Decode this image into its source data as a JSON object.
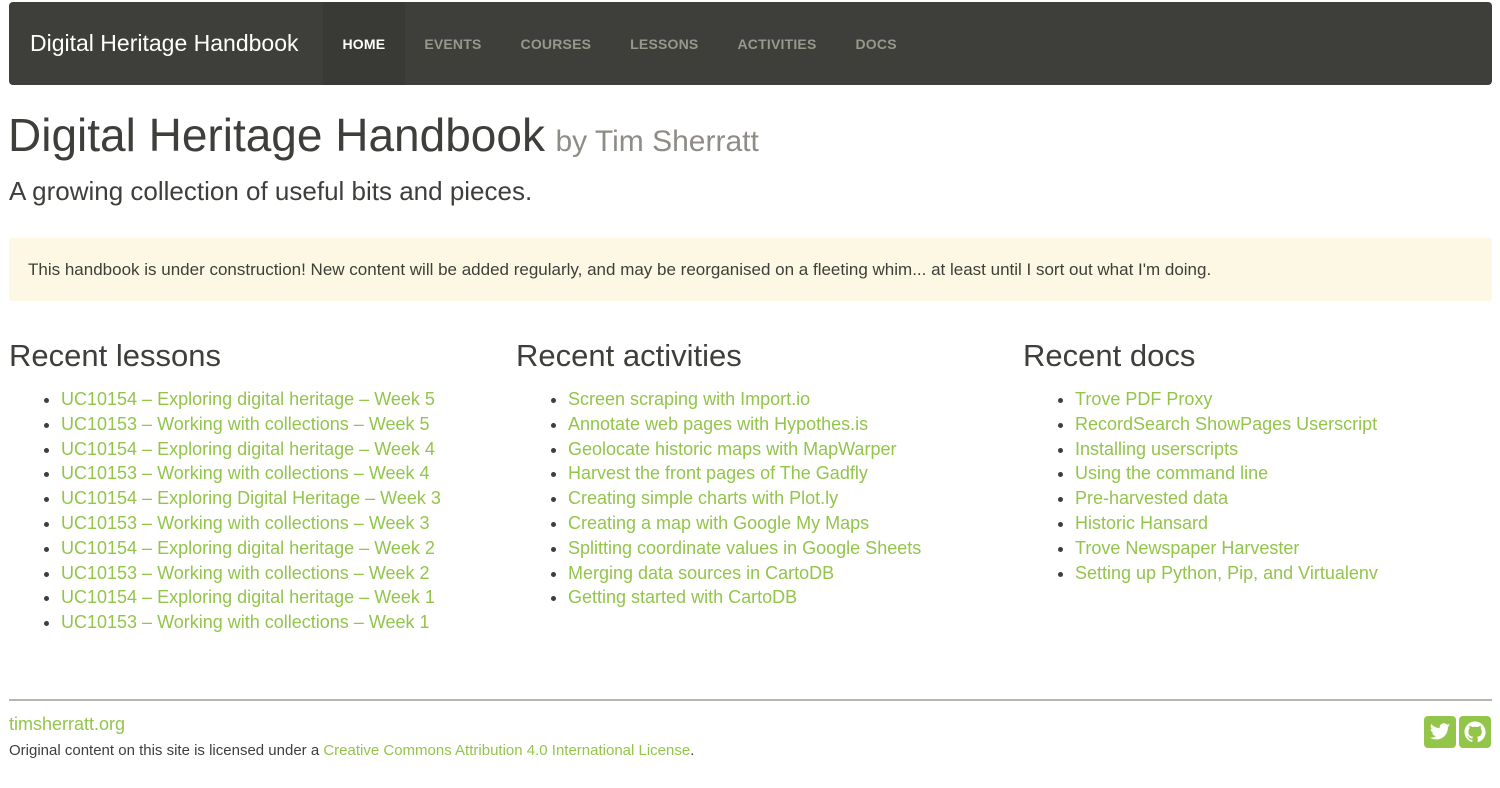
{
  "navbar": {
    "brand": "Digital Heritage Handbook",
    "items": [
      {
        "label": "HOME"
      },
      {
        "label": "EVENTS"
      },
      {
        "label": "COURSES"
      },
      {
        "label": "LESSONS"
      },
      {
        "label": "ACTIVITIES"
      },
      {
        "label": "DOCS"
      }
    ]
  },
  "header": {
    "title": "Digital Heritage Handbook",
    "byline": "by Tim Sherratt",
    "lead": "A growing collection of useful bits and pieces."
  },
  "notice": {
    "text": "This handbook is under construction! New content will be added regularly, and may be reorganised on a fleeting whim... at least until I sort out what I'm doing."
  },
  "lessons": {
    "heading": "Recent lessons",
    "items": [
      "UC10154 – Exploring digital heritage – Week 5",
      "UC10153 – Working with collections – Week 5",
      "UC10154 – Exploring digital heritage – Week 4",
      "UC10153 – Working with collections – Week 4",
      "UC10154 – Exploring Digital Heritage – Week 3",
      "UC10153 – Working with collections – Week 3",
      "UC10154 – Exploring digital heritage – Week 2",
      "UC10153 – Working with collections – Week 2",
      "UC10154 – Exploring digital heritage – Week 1",
      "UC10153 – Working with collections – Week 1"
    ]
  },
  "activities": {
    "heading": "Recent activities",
    "items": [
      "Screen scraping with Import.io",
      "Annotate web pages with Hypothes.is",
      "Geolocate historic maps with MapWarper",
      "Harvest the front pages of The Gadfly",
      "Creating simple charts with Plot.ly",
      "Creating a map with Google My Maps",
      "Splitting coordinate values in Google Sheets",
      "Merging data sources in CartoDB",
      "Getting started with CartoDB"
    ]
  },
  "docs": {
    "heading": "Recent docs",
    "items": [
      "Trove PDF Proxy",
      "RecordSearch ShowPages Userscript",
      "Installing userscripts",
      "Using the command line",
      "Pre-harvested data",
      "Historic Hansard",
      "Trove Newspaper Harvester",
      "Setting up Python, Pip, and Virtualenv"
    ]
  },
  "footer": {
    "site": "timsherratt.org",
    "license_prefix": "Original content on this site is licensed under a ",
    "license_link": "Creative Commons Attribution 4.0 International License",
    "license_suffix": ".",
    "icons": [
      "twitter-icon",
      "github-icon"
    ]
  },
  "colors": {
    "navbar_bg": "#3e3f3a",
    "link": "#93c54b",
    "notice_bg": "#fcf8e3"
  }
}
